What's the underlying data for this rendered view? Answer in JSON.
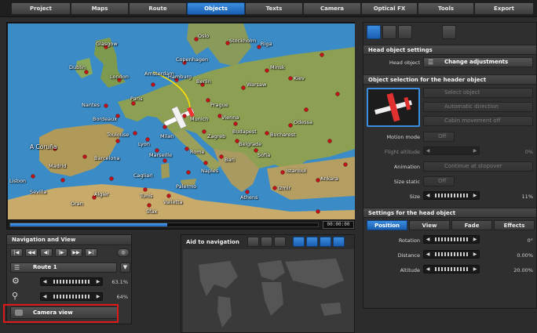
{
  "tabs": [
    {
      "label": "Project",
      "active": false
    },
    {
      "label": "Maps",
      "active": false
    },
    {
      "label": "Route",
      "active": false
    },
    {
      "label": "Objects",
      "active": true
    },
    {
      "label": "Texts",
      "active": false
    },
    {
      "label": "Camera",
      "active": false
    },
    {
      "label": "Optical FX",
      "active": false
    },
    {
      "label": "Tools",
      "active": false
    },
    {
      "label": "Export",
      "active": false
    }
  ],
  "map": {
    "cities": [
      "A Coruña",
      "Lisbon",
      "Sevilla",
      "Madrid",
      "Algier",
      "Tunis",
      "Valletta",
      "Oran",
      "Sfax",
      "Palermo",
      "Cagliari",
      "Barcelona",
      "Toulouse",
      "Bordeaux",
      "Nantes",
      "Paris",
      "London",
      "Dublin",
      "Glasgow",
      "Amsterdam",
      "Hamburg",
      "Berlin",
      "Munich",
      "Prague",
      "Vienna",
      "Budapest",
      "Warsaw",
      "Milan",
      "Rome",
      "Naples",
      "Bari",
      "Athens",
      "Sofia",
      "Bucharest",
      "Belgrade",
      "Odessa",
      "Istanbul",
      "Ankara",
      "Izmir",
      "Kiev",
      "Minsk",
      "Riga",
      "Oslo",
      "Stockholm",
      "Copenhagen",
      "Lyon",
      "Marseille",
      "Zagreb"
    ],
    "time_display": "00:00:00",
    "progress": 0.51
  },
  "navigation": {
    "title": "Navigation and View",
    "transport_buttons": [
      "|◀",
      "◀◀",
      "◀|",
      "|▶",
      "▶▶",
      "▶|"
    ],
    "route_label": "Route 1",
    "speed_percent": "63.1%",
    "zoom_percent": "64%",
    "camera_view_label": "Camera view"
  },
  "aid": {
    "title": "Aid to navigation"
  },
  "right": {
    "head_settings_title": "Head object settings",
    "head_object_label": "Head object",
    "change_adjustments_label": "Change adjustments",
    "selection_title": "Object selection for the header object",
    "select_object_label": "Select object",
    "automatic_direction_label": "Automatic direction",
    "cabin_movement_label": "Cabin movement off",
    "motion_mode_label": "Motion mode",
    "motion_mode_value": "Off",
    "flight_altitude_label": "Flight altitude",
    "flight_altitude_value": "0%",
    "animation_label": "Animation",
    "animation_value": "Continue at stopover",
    "size_static_label": "Size static",
    "size_static_value": "Off",
    "size_label": "Size",
    "size_value": "11%",
    "settings_title": "Settings for the head object",
    "sub_tabs": [
      {
        "label": "Position",
        "active": true
      },
      {
        "label": "View",
        "active": false
      },
      {
        "label": "Fade",
        "active": false
      },
      {
        "label": "Effects",
        "active": false
      }
    ],
    "rotation_label": "Rotation",
    "rotation_value": "0°",
    "distance_label": "Distance",
    "distance_value": "0.00%",
    "altitude_label": "Altitude",
    "altitude_value": "20.00%"
  }
}
